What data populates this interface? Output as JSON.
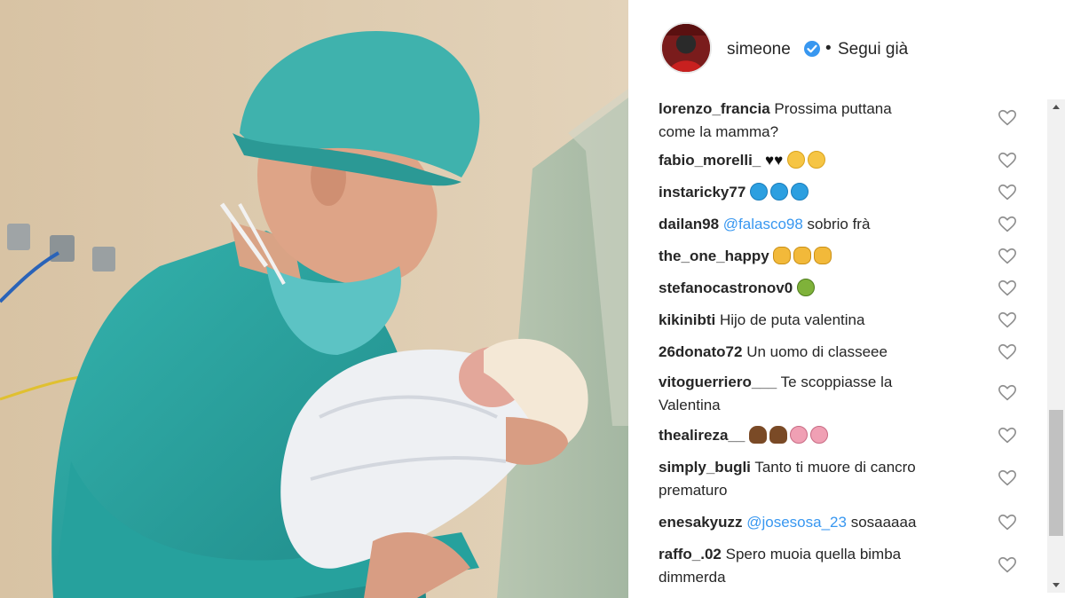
{
  "post": {
    "username": "simeone",
    "separator": "•",
    "follow_status": "Segui già"
  },
  "comments": [
    {
      "user": "lorenzo_francia",
      "text": "Prossima puttana come la mamma?",
      "line1": "Prossima puttana",
      "line2": "come la mamma?"
    },
    {
      "user": "fabio_morelli_",
      "text": "♥♥",
      "emojis": [
        "smile-emoji",
        "smile-emoji"
      ]
    },
    {
      "user": "instaricky77",
      "text": "",
      "emojis": [
        "blue-circle-emoji",
        "blue-circle-emoji",
        "blue-circle-emoji"
      ]
    },
    {
      "user": "dailan98",
      "mention": "@falasco98",
      "text": "sobrio frà"
    },
    {
      "user": "the_one_happy",
      "text": "",
      "emojis": [
        "clap-emoji",
        "clap-emoji",
        "clap-emoji"
      ]
    },
    {
      "user": "stefanocastronov0",
      "text": "",
      "emojis": [
        "nauseated-face-emoji"
      ]
    },
    {
      "user": "kikinibti",
      "text": "Hijo de puta valentina"
    },
    {
      "user": "26donato72",
      "text": "Un uomo di classeee"
    },
    {
      "user": "vitoguerriero___",
      "text": "Te scoppiasse la Valentina",
      "line1": "Te scoppiasse la",
      "line2": "Valentina"
    },
    {
      "user": "thealireza__",
      "text": "",
      "emojis": [
        "poop-emoji",
        "poop-emoji",
        "pig-emoji",
        "pig-emoji"
      ]
    },
    {
      "user": "simply_bugli",
      "text": "Tanto ti muore di cancro prematuro",
      "line1": "Tanto ti muore di cancro",
      "line2": "prematuro"
    },
    {
      "user": "enesakyuzz",
      "mention": "@josesosa_23",
      "text": "sosaaaaa"
    },
    {
      "user": "raffo_.02",
      "text": "Spero muoia quella bimba dimmerda",
      "line1": "Spero muoia quella bimba",
      "line2": "dimmerda"
    }
  ],
  "colors": {
    "accent": "#3897f0",
    "text": "#262626",
    "scrubs": "#2aa3a0"
  },
  "icons": {
    "like": "heart-icon",
    "verified": "verified-badge-icon"
  }
}
